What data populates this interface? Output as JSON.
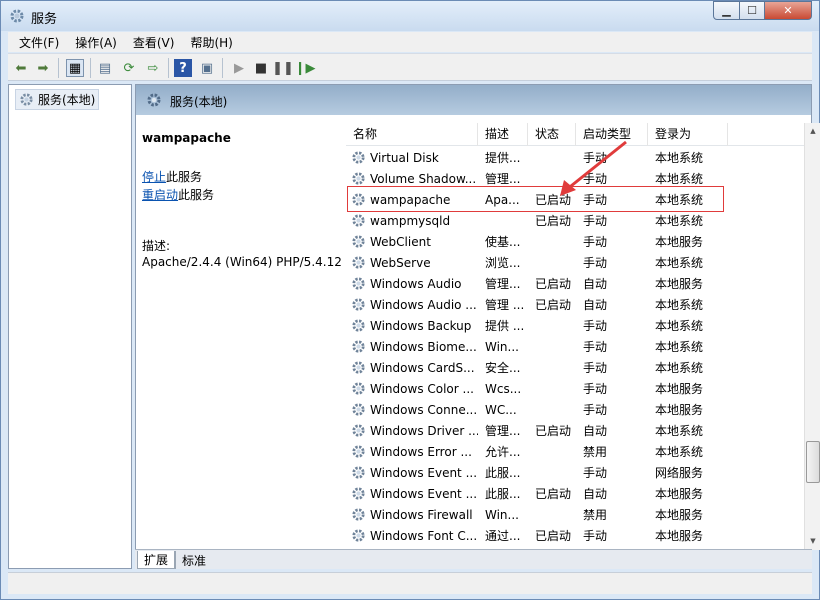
{
  "window": {
    "title": "服务"
  },
  "menu": [
    {
      "label": "文件(F)"
    },
    {
      "label": "操作(A)"
    },
    {
      "label": "查看(V)"
    },
    {
      "label": "帮助(H)"
    }
  ],
  "tree": {
    "root": "服务(本地)"
  },
  "header": {
    "title": "服务(本地)"
  },
  "detail": {
    "service_name": "wampapache",
    "stop_link": "停止",
    "stop_suffix": "此服务",
    "restart_link": "重启动",
    "restart_suffix": "此服务",
    "desc_label": "描述:",
    "description": "Apache/2.4.4 (Win64) PHP/5.4.12"
  },
  "columns": [
    {
      "label": "名称"
    },
    {
      "label": "描述"
    },
    {
      "label": "状态"
    },
    {
      "label": "启动类型"
    },
    {
      "label": "登录为"
    }
  ],
  "rows": [
    {
      "name": "Virtual Disk",
      "desc": "提供...",
      "status": "",
      "startup": "手动",
      "logon": "本地系统"
    },
    {
      "name": "Volume Shadow...",
      "desc": "管理...",
      "status": "",
      "startup": "手动",
      "logon": "本地系统"
    },
    {
      "name": "wampapache",
      "desc": "Apa...",
      "status": "已启动",
      "startup": "手动",
      "logon": "本地系统"
    },
    {
      "name": "wampmysqld",
      "desc": "",
      "status": "已启动",
      "startup": "手动",
      "logon": "本地系统"
    },
    {
      "name": "WebClient",
      "desc": "使基...",
      "status": "",
      "startup": "手动",
      "logon": "本地服务"
    },
    {
      "name": "WebServe",
      "desc": "浏览...",
      "status": "",
      "startup": "手动",
      "logon": "本地系统"
    },
    {
      "name": "Windows Audio",
      "desc": "管理...",
      "status": "已启动",
      "startup": "自动",
      "logon": "本地服务"
    },
    {
      "name": "Windows Audio ...",
      "desc": "管理 ...",
      "status": "已启动",
      "startup": "自动",
      "logon": "本地系统"
    },
    {
      "name": "Windows Backup",
      "desc": "提供 ...",
      "status": "",
      "startup": "手动",
      "logon": "本地系统"
    },
    {
      "name": "Windows Biome...",
      "desc": "Win...",
      "status": "",
      "startup": "手动",
      "logon": "本地系统"
    },
    {
      "name": "Windows CardS...",
      "desc": "安全...",
      "status": "",
      "startup": "手动",
      "logon": "本地系统"
    },
    {
      "name": "Windows Color ...",
      "desc": "Wcs...",
      "status": "",
      "startup": "手动",
      "logon": "本地服务"
    },
    {
      "name": "Windows Conne...",
      "desc": "WC...",
      "status": "",
      "startup": "手动",
      "logon": "本地服务"
    },
    {
      "name": "Windows Driver ...",
      "desc": "管理...",
      "status": "已启动",
      "startup": "自动",
      "logon": "本地系统"
    },
    {
      "name": "Windows Error ...",
      "desc": "允许...",
      "status": "",
      "startup": "禁用",
      "logon": "本地系统"
    },
    {
      "name": "Windows Event ...",
      "desc": "此服...",
      "status": "",
      "startup": "手动",
      "logon": "网络服务"
    },
    {
      "name": "Windows Event ...",
      "desc": "此服...",
      "status": "已启动",
      "startup": "自动",
      "logon": "本地服务"
    },
    {
      "name": "Windows Firewall",
      "desc": "Win...",
      "status": "",
      "startup": "禁用",
      "logon": "本地服务"
    },
    {
      "name": "Windows Font C...",
      "desc": "通过...",
      "status": "已启动",
      "startup": "手动",
      "logon": "本地服务"
    }
  ],
  "tabs": [
    {
      "label": "扩展"
    },
    {
      "label": "标准"
    }
  ],
  "colors": {
    "highlight": "#e03b3b",
    "header": "#93aec9",
    "link": "#0a53b0"
  }
}
